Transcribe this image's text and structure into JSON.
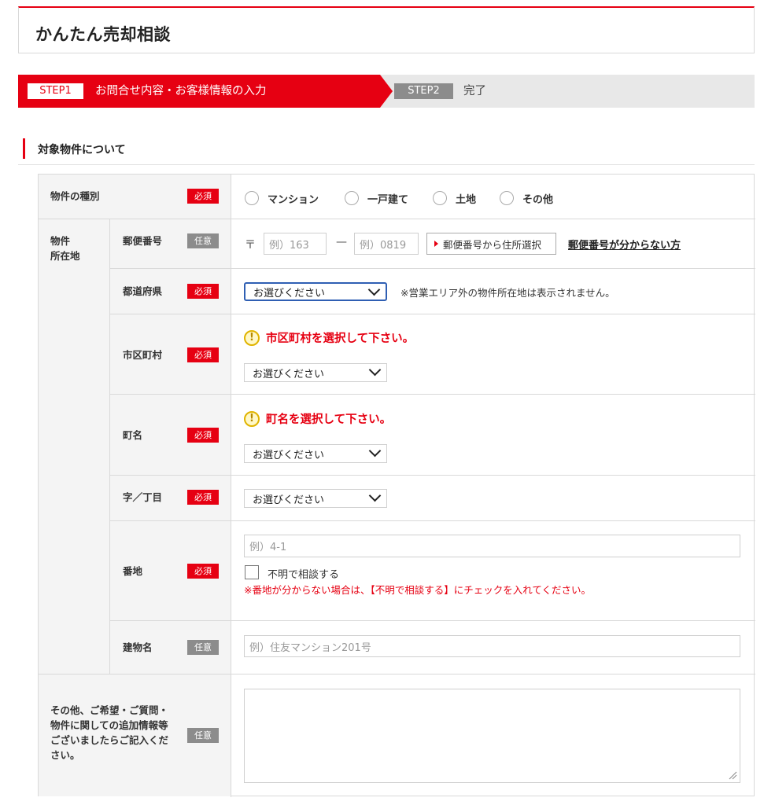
{
  "page": {
    "title": "かんたん売却相談"
  },
  "steps": [
    {
      "badge": "STEP1",
      "label": "お問合せ内容・お客様情報の入力"
    },
    {
      "badge": "STEP2",
      "label": "完了"
    }
  ],
  "section": {
    "title": "対象物件について"
  },
  "badges": {
    "required": "必須",
    "optional": "任意"
  },
  "property_type": {
    "label": "物件の種別",
    "options": [
      "マンション",
      "一戸建て",
      "土地",
      "その他"
    ]
  },
  "location": {
    "label_line1": "物件",
    "label_line2": "所在地",
    "postal": {
      "label": "郵便番号",
      "mark": "〒",
      "placeholder1": "例）163",
      "separator": "—",
      "placeholder2": "例）0819",
      "button": "郵便番号から住所選択",
      "link": "郵便番号が分からない方"
    },
    "prefecture": {
      "label": "都道府県",
      "selected": "お選びください",
      "note": "※営業エリア外の物件所在地は表示されません。"
    },
    "city": {
      "label": "市区町村",
      "error": "市区町村を選択して下さい。",
      "selected": "お選びください"
    },
    "town": {
      "label": "町名",
      "error": "町名を選択して下さい。",
      "selected": "お選びください"
    },
    "chome": {
      "label": "字／丁目",
      "selected": "お選びください"
    },
    "banchi": {
      "label": "番地",
      "placeholder": "例）4-1",
      "checkbox_label": "不明で相談する",
      "note": "※番地が分からない場合は、【不明で相談する】にチェックを入れてください。"
    },
    "building": {
      "label": "建物名",
      "placeholder": "例）住友マンション201号"
    }
  },
  "other": {
    "label_line1": "その他、ご希望・ご質問・",
    "label_line2": "物件に関しての追加情報等",
    "label_line3": "ございましたらご記入くだ",
    "label_line4": "さい。"
  },
  "icons": {
    "warning": "!"
  },
  "colors": {
    "accent": "#e60012",
    "optional_badge": "#8c8c8c",
    "focus": "#2f5fb3"
  }
}
